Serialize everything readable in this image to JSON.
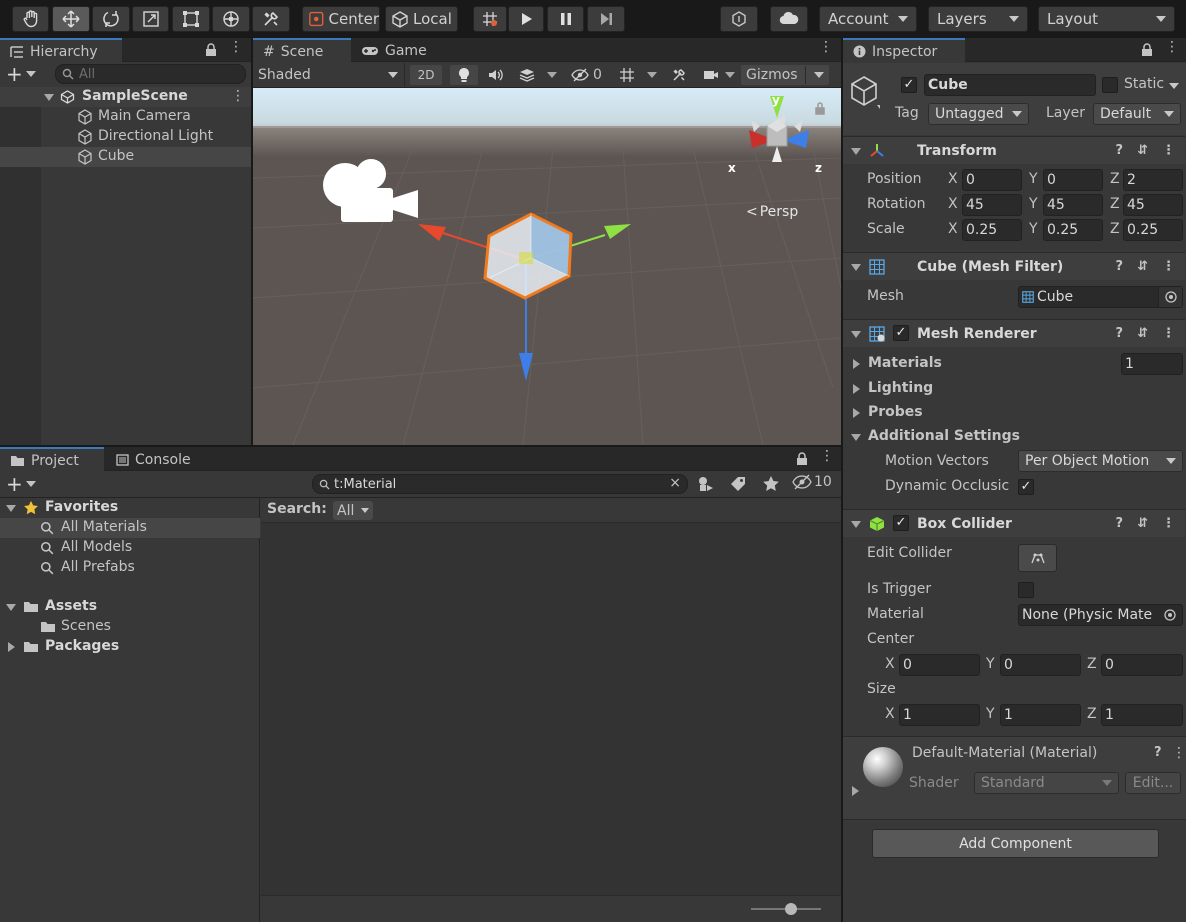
{
  "toolbar": {
    "tools": [
      "hand-tool",
      "move-tool",
      "rotate-tool",
      "scale-tool",
      "rect-tool",
      "transform-tool",
      "custom-tool"
    ],
    "pivot_label": "Center",
    "space_label": "Local",
    "account_label": "Account",
    "layers_label": "Layers",
    "layout_label": "Layout"
  },
  "hierarchy": {
    "tab_label": "Hierarchy",
    "search_placeholder": "All",
    "scene_name": "SampleScene",
    "items": [
      {
        "label": "Main Camera"
      },
      {
        "label": "Directional Light"
      },
      {
        "label": "Cube"
      }
    ]
  },
  "scene": {
    "tab_label": "Scene",
    "game_tab_label": "Game",
    "shading_mode": "Shaded",
    "mode_2d": "2D",
    "hidden_count": "0",
    "gizmos_label": "Gizmos",
    "persp_label": "Persp",
    "axis_x": "x",
    "axis_y": "y",
    "axis_z": "z"
  },
  "project": {
    "tab_label": "Project",
    "console_tab_label": "Console",
    "search_value": "t:Material",
    "hidden_packages": "10",
    "search_label": "Search:",
    "search_scope": "All",
    "favorites_label": "Favorites",
    "favorites": [
      "All Materials",
      "All Models",
      "All Prefabs"
    ],
    "assets_label": "Assets",
    "asset_folders": [
      "Scenes"
    ],
    "packages_label": "Packages"
  },
  "inspector": {
    "tab_label": "Inspector",
    "object_name": "Cube",
    "static_label": "Static",
    "tag_label": "Tag",
    "tag_value": "Untagged",
    "layer_label": "Layer",
    "layer_value": "Default",
    "transform": {
      "title": "Transform",
      "rows": [
        {
          "label": "Position",
          "x": "0",
          "y": "0",
          "z": "2"
        },
        {
          "label": "Rotation",
          "x": "45",
          "y": "45",
          "z": "45"
        },
        {
          "label": "Scale",
          "x": "0.25",
          "y": "0.25",
          "z": "0.25"
        }
      ],
      "axis_x": "X",
      "axis_y": "Y",
      "axis_z": "Z"
    },
    "mesh_filter": {
      "title": "Cube (Mesh Filter)",
      "mesh_label": "Mesh",
      "mesh_value": "Cube"
    },
    "mesh_renderer": {
      "title": "Mesh Renderer",
      "materials_label": "Materials",
      "materials_count": "1",
      "lighting_label": "Lighting",
      "probes_label": "Probes",
      "additional_label": "Additional Settings",
      "motion_vectors_label": "Motion Vectors",
      "motion_vectors_value": "Per Object Motion",
      "dynamic_occlusion_label": "Dynamic Occlusic"
    },
    "box_collider": {
      "title": "Box Collider",
      "edit_label": "Edit Collider",
      "trigger_label": "Is Trigger",
      "material_label": "Material",
      "material_value": "None (Physic Mate",
      "center_label": "Center",
      "center": {
        "x": "0",
        "y": "0",
        "z": "0"
      },
      "size_label": "Size",
      "size": {
        "x": "1",
        "y": "1",
        "z": "1"
      }
    },
    "material": {
      "title": "Default-Material (Material)",
      "shader_label": "Shader",
      "shader_value": "Standard",
      "edit_label": "Edit..."
    },
    "add_component_label": "Add Component"
  },
  "colors": {
    "accent": "#3a79bb",
    "panel": "#383838",
    "header": "#3e3e3e",
    "axis_red": "#e8492d",
    "axis_green": "#8ee044",
    "axis_blue": "#3e7ee8",
    "selection_orange": "#f07b1e"
  }
}
